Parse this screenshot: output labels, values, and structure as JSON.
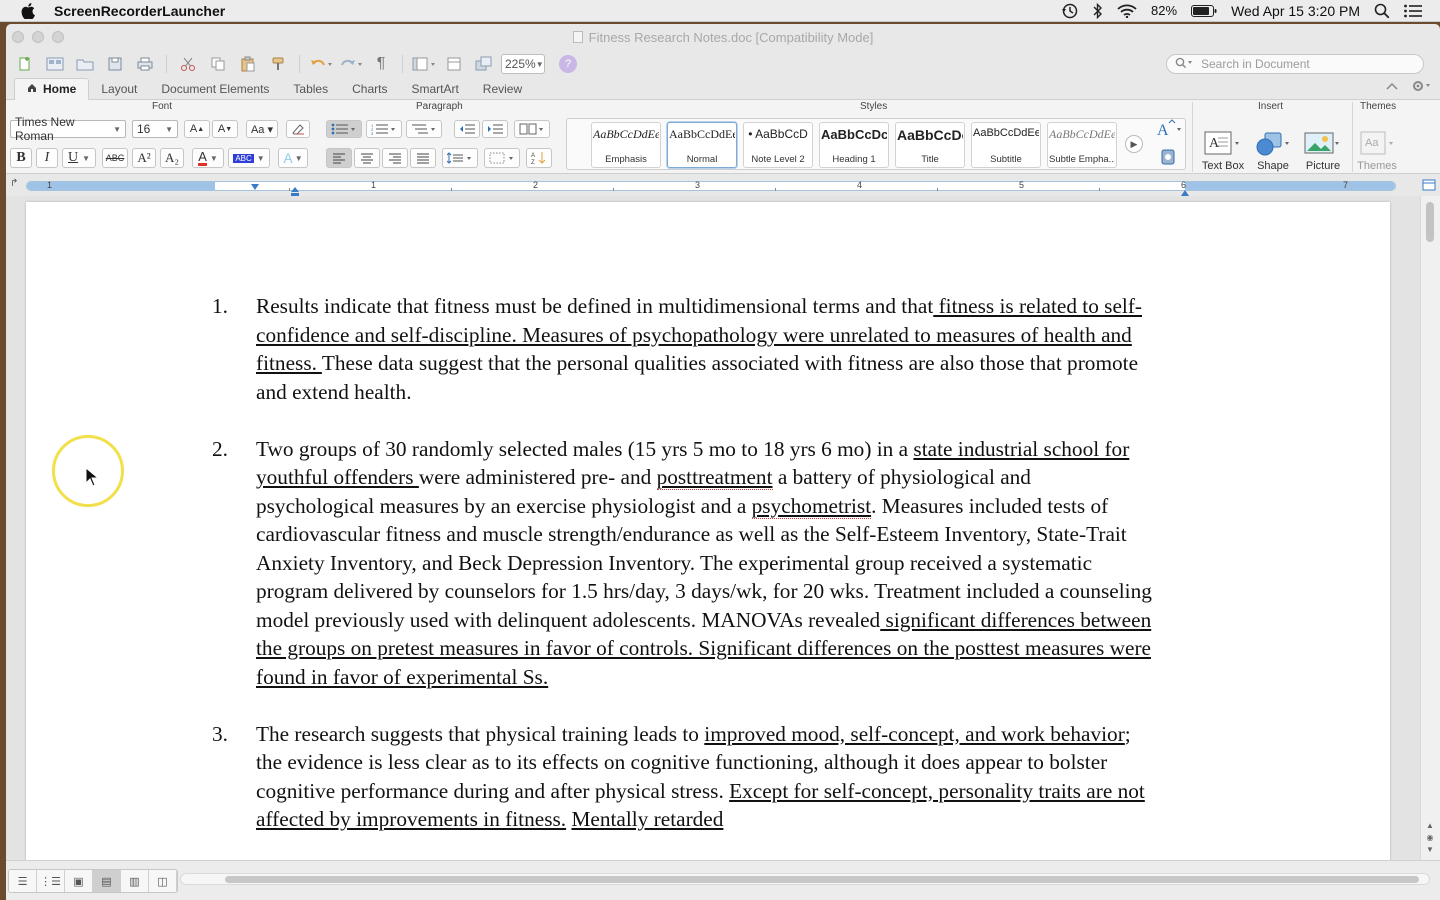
{
  "menubar": {
    "app_name": "ScreenRecorderLauncher",
    "battery": "82%",
    "datetime": "Wed Apr 15  3:20 PM",
    "icons": [
      "apple-icon",
      "time-machine-icon",
      "bluetooth-icon",
      "wifi-icon",
      "battery-icon",
      "spotlight-icon",
      "notification-center-icon"
    ]
  },
  "window": {
    "title": "Fitness Research Notes.doc [Compatibility Mode]",
    "zoom": "225%",
    "search_placeholder": "Search in Document"
  },
  "tabs": [
    "Home",
    "Layout",
    "Document Elements",
    "Tables",
    "Charts",
    "SmartArt",
    "Review"
  ],
  "ribbon": {
    "groups": {
      "font": "Font",
      "paragraph": "Paragraph",
      "styles": "Styles",
      "insert": "Insert",
      "themes": "Themes"
    },
    "font_name": "Times New Roman",
    "font_size": "16",
    "styles": [
      {
        "sample": "AaBbCcDdEe",
        "name": "Emphasis"
      },
      {
        "sample": "AaBbCcDdEe",
        "name": "Normal"
      },
      {
        "sample": "• AaBbCcD",
        "name": "Note Level 2"
      },
      {
        "sample": "AaBbCcDc",
        "name": "Heading 1"
      },
      {
        "sample": "AaBbCcDc",
        "name": "Title"
      },
      {
        "sample": "AaBbCcDdEe",
        "name": "Subtitle"
      },
      {
        "sample": "AaBbCcDdEe",
        "name": "Subtle Empha..."
      }
    ],
    "insert_items": [
      "Text Box",
      "Shape",
      "Picture"
    ],
    "themes_label": "Themes",
    "format_buttons": {
      "bold": "B",
      "italic": "I",
      "underline": "U",
      "strike": "ABC",
      "superscript": "A²",
      "subscript": "A₂"
    }
  },
  "ruler": {
    "numbers": [
      "1",
      "1",
      "2",
      "3",
      "4",
      "5",
      "6",
      "7"
    ]
  },
  "document": {
    "items": [
      {
        "num": "1.",
        "segments": [
          {
            "t": "Results indicate that  fitness must be defined in multidimensional terms and that",
            "u": false
          },
          {
            "t": " fitness is related to self-confidence and self-discipline. Measures of psychopathology were unrelated to measures of health and fitness. ",
            "u": true
          },
          {
            "t": "These data suggest that the personal qualities associated with fitness are also those that promote and extend health.",
            "u": false
          }
        ]
      },
      {
        "num": "2.",
        "segments": [
          {
            "t": "Two groups of 30 randomly selected males (15 yrs 5 mo to 18 yrs 6 mo) in a ",
            "u": false
          },
          {
            "t": "state industrial school for youthful offenders ",
            "u": true
          },
          {
            "t": "were administered pre- and ",
            "u": false
          },
          {
            "t": "posttreatment",
            "u": true,
            "sp": true
          },
          {
            "t": " a battery of physiological and psychological measures by an exercise physiologist and a ",
            "u": false
          },
          {
            "t": "psychometrist",
            "u": true,
            "sp": true
          },
          {
            "t": ". Measures included tests of cardiovascular fitness and muscle strength/endurance as well as the Self-Esteem Inventory, State-Trait Anxiety Inventory, and Beck Depression Inventory. The experimental group received a systematic  program delivered by counselors for 1.5 hrs/day, 3 days/wk, for 20 wks. Treatment included a counseling model previously used with delinquent adolescents. MANOVAs revealed",
            "u": false
          },
          {
            "t": " significant differences between the groups on pretest measures in favor of controls. Significant differences on the posttest measures were found in favor of experimental Ss.",
            "u": true
          }
        ]
      },
      {
        "num": "3.",
        "segments": [
          {
            "t": "The research suggests that physical training leads to ",
            "u": false
          },
          {
            "t": "improved mood, self-concept, and work behavior",
            "u": true
          },
          {
            "t": "; the evidence is less clear as to its effects on cognitive functioning, although it does appear to bolster cognitive performance during and after physical stress. ",
            "u": false
          },
          {
            "t": "Except for self-concept, personality traits are not affected by improvements in fitness.",
            "u": true
          },
          {
            "t": " ",
            "u": false
          },
          {
            "t": "Mentally retarded",
            "u": true
          }
        ]
      }
    ]
  }
}
